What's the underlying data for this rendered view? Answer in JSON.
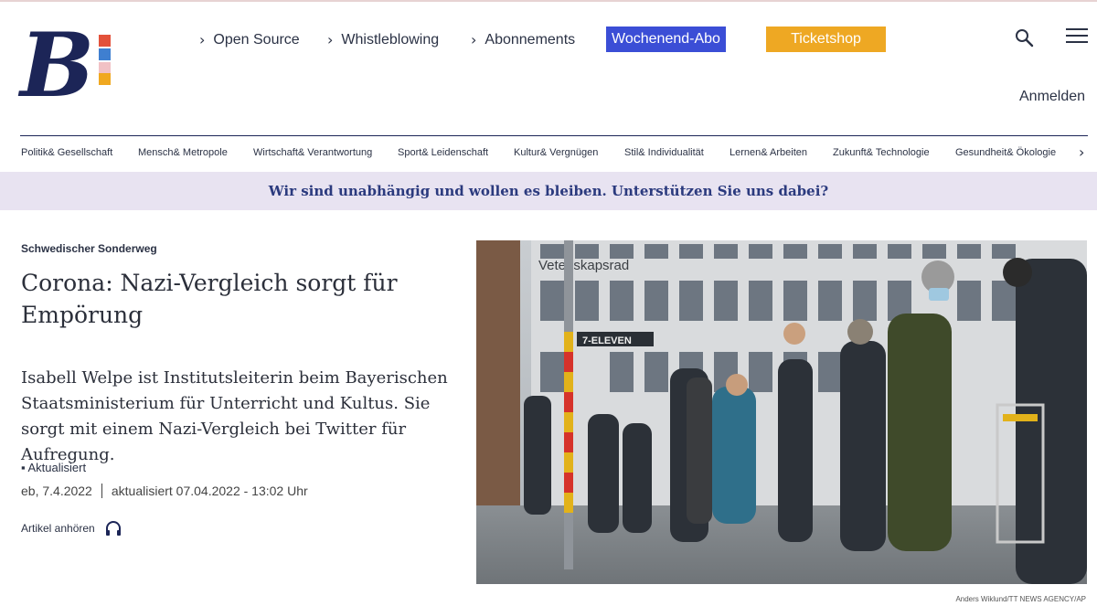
{
  "brand": {
    "logo_letter": "B",
    "colors": {
      "navy": "#1c2557",
      "square_1": "#e3513a",
      "square_2": "#3f7fd0",
      "square_3": "#f1c1c5",
      "square_4": "#f0a820"
    }
  },
  "header": {
    "links": [
      {
        "label": "Open Source",
        "icon": "chevron-right-icon"
      },
      {
        "label": "Whistleblowing",
        "icon": "chevron-right-icon"
      },
      {
        "label": "Abonnements",
        "icon": "chevron-right-icon"
      }
    ],
    "abo_button": {
      "label": "Wochenend-Abo",
      "color": "#3b4ed6"
    },
    "ticket_button": {
      "label": "Ticketshop",
      "color": "#eea823"
    },
    "search_icon": "search-icon",
    "menu_icon": "menu-icon",
    "login_label": "Anmelden"
  },
  "categories": [
    "Politik& Gesellschaft",
    "Mensch& Metropole",
    "Wirtschaft& Verantwortung",
    "Sport& Leidenschaft",
    "Kultur& Vergnügen",
    "Stil& Individualität",
    "Lernen& Arbeiten",
    "Zukunft& Technologie",
    "Gesundheit& Ökologie"
  ],
  "banner": {
    "text": "Wir sind unabhängig und wollen es bleiben. Unterstützen Sie uns dabei?",
    "bg_color": "#e8e3f1",
    "text_color": "#2b3a7e"
  },
  "article": {
    "kicker": "Schwedischer Sonderweg",
    "headline": "Corona: Nazi-Vergleich sorgt für Empörung",
    "lead": "Isabell Welpe ist Institutsleiterin beim Bayerischen Staatsministerium für Unterricht und Kultus. Sie sorgt mit einem Nazi-Vergleich bei Twitter für Aufregung.",
    "updated_label": "▪ Aktualisiert",
    "byline_date": "eb, 7.4.2022",
    "updated_date": "aktualisiert 07.04.2022 - 13:02 Uhr",
    "audio_label": "Artikel anhören",
    "audio_icon": "headphones-icon"
  },
  "photo": {
    "sign_text": "Vetenskapsrad",
    "shop_sign": "7-ELEVEN",
    "credit": "Anders Wiklund/TT NEWS AGENCY/AP"
  }
}
